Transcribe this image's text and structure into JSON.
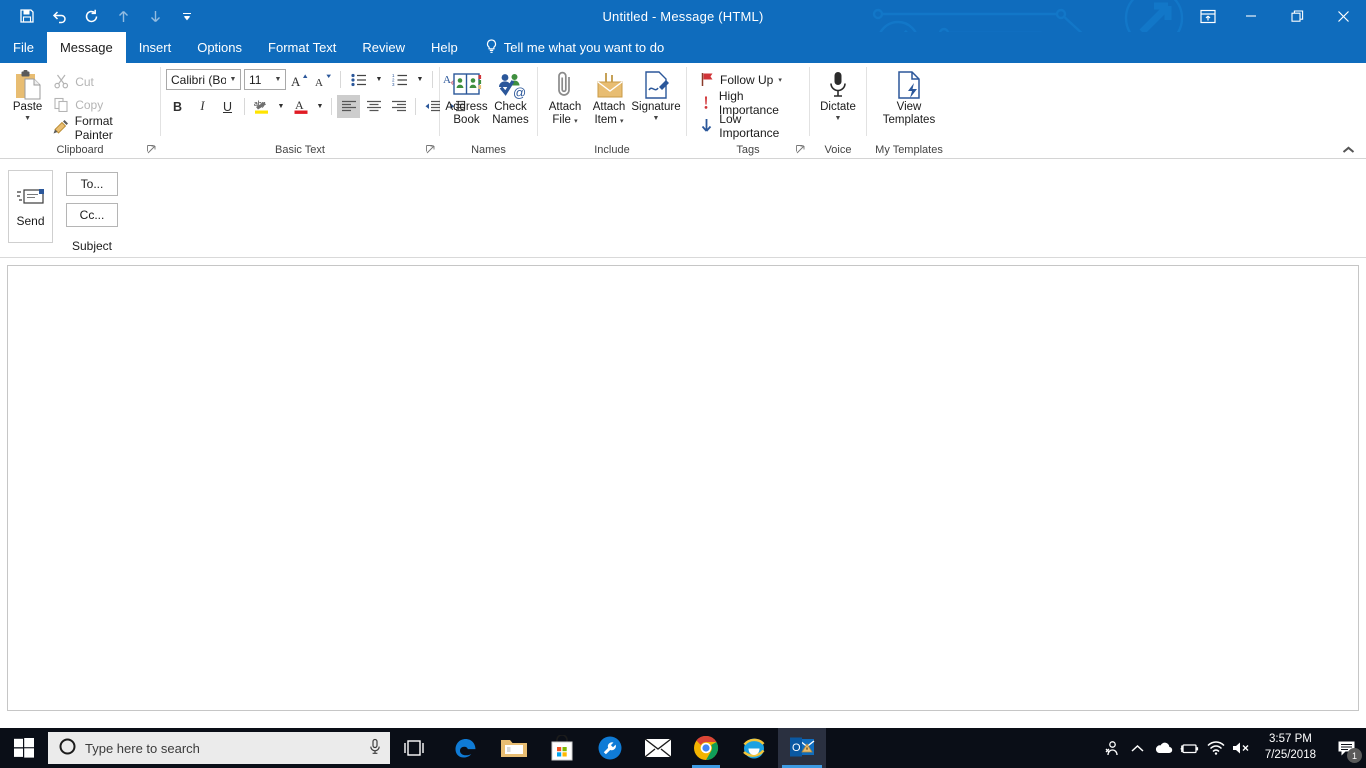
{
  "window": {
    "title": "Untitled  -  Message (HTML)",
    "quick_access": [
      {
        "name": "save-icon",
        "label": "Save"
      },
      {
        "name": "undo-icon",
        "label": "Undo"
      },
      {
        "name": "redo-icon",
        "label": "Redo"
      },
      {
        "name": "previous-item-icon",
        "label": "Previous Item"
      },
      {
        "name": "next-item-icon",
        "label": "Next Item"
      },
      {
        "name": "customize-quick-access-toolbar-icon",
        "label": "Customize Quick Access Toolbar"
      }
    ],
    "controls": [
      {
        "name": "ribbon-display-options-button",
        "label": "Ribbon Display Options"
      },
      {
        "name": "minimize-button",
        "label": "Minimize"
      },
      {
        "name": "restore-button",
        "label": "Restore Down"
      },
      {
        "name": "close-button",
        "label": "Close"
      }
    ],
    "accent_color": "#0f6cbd"
  },
  "tabs": [
    {
      "label": "File",
      "active": false
    },
    {
      "label": "Message",
      "active": true
    },
    {
      "label": "Insert",
      "active": false
    },
    {
      "label": "Options",
      "active": false
    },
    {
      "label": "Format Text",
      "active": false
    },
    {
      "label": "Review",
      "active": false
    },
    {
      "label": "Help",
      "active": false
    }
  ],
  "tell_me": {
    "label": "Tell me what you want to do",
    "icon": "lightbulb-icon"
  },
  "ribbon": {
    "collapse_label": "Collapse the Ribbon",
    "groups": {
      "clipboard": {
        "label": "Clipboard",
        "paste": "Paste",
        "cut": "Cut",
        "copy": "Copy",
        "format_painter": "Format Painter"
      },
      "basic_text": {
        "label": "Basic Text",
        "font_name": "Calibri (Bod",
        "font_size": "11",
        "grow_font": "Grow Font",
        "shrink_font": "Shrink Font",
        "bullets": "Bullets",
        "numbering": "Numbering",
        "clear_formatting": "Clear All Formatting",
        "bold": "B",
        "italic": "I",
        "underline": "U",
        "highlight": "Text Highlight Color",
        "font_color": "Font Color",
        "align_left": "Align Left",
        "align_center": "Center",
        "align_right": "Align Right",
        "decrease_indent": "Decrease Indent",
        "increase_indent": "Increase Indent"
      },
      "names": {
        "label": "Names",
        "address_book": "Address\nBook",
        "address_book_line1": "Address",
        "address_book_line2": "Book",
        "check_names_line1": "Check",
        "check_names_line2": "Names"
      },
      "include": {
        "label": "Include",
        "attach_file_line1": "Attach",
        "attach_file_line2": "File",
        "attach_item_line1": "Attach",
        "attach_item_line2": "Item",
        "signature": "Signature"
      },
      "tags": {
        "label": "Tags",
        "follow_up": "Follow Up",
        "high_importance": "High Importance",
        "low_importance": "Low Importance"
      },
      "voice": {
        "label": "Voice",
        "dictate": "Dictate"
      },
      "my_templates": {
        "label": "My Templates",
        "view_templates_line1": "View",
        "view_templates_line2": "Templates"
      }
    }
  },
  "compose": {
    "send_label": "Send",
    "to_label": "To...",
    "cc_label": "Cc...",
    "subject_label": "Subject",
    "to_value": "",
    "cc_value": "",
    "subject_value": "",
    "to_placeholder": "",
    "cc_placeholder": "",
    "subject_placeholder": "",
    "body_value": ""
  },
  "taskbar": {
    "start_label": "Start",
    "search_placeholder": "Type here to search",
    "search_value": "",
    "cortana_icon": "cortana-circle-icon",
    "mic_icon": "microphone-icon",
    "task_view_label": "Task View",
    "apps": [
      {
        "name": "taskbar-edge",
        "label": "Microsoft Edge"
      },
      {
        "name": "taskbar-file-explorer",
        "label": "File Explorer"
      },
      {
        "name": "taskbar-microsoft-store",
        "label": "Microsoft Store"
      },
      {
        "name": "taskbar-tool",
        "label": "Settings Tool"
      },
      {
        "name": "taskbar-mail",
        "label": "Mail"
      },
      {
        "name": "taskbar-chrome",
        "label": "Google Chrome"
      },
      {
        "name": "taskbar-internet-explorer",
        "label": "Internet Explorer"
      },
      {
        "name": "taskbar-outlook",
        "label": "Outlook"
      }
    ],
    "tray": [
      {
        "name": "people-icon",
        "label": "People"
      },
      {
        "name": "show-hidden-icons-icon",
        "label": "Show hidden icons"
      },
      {
        "name": "onedrive-icon",
        "label": "OneDrive"
      },
      {
        "name": "battery-icon",
        "label": "Battery"
      },
      {
        "name": "wifi-icon",
        "label": "Network"
      },
      {
        "name": "volume-muted-icon",
        "label": "Volume muted"
      }
    ],
    "clock_time": "3:57 PM",
    "clock_date": "7/25/2018",
    "notification_count": "1"
  }
}
